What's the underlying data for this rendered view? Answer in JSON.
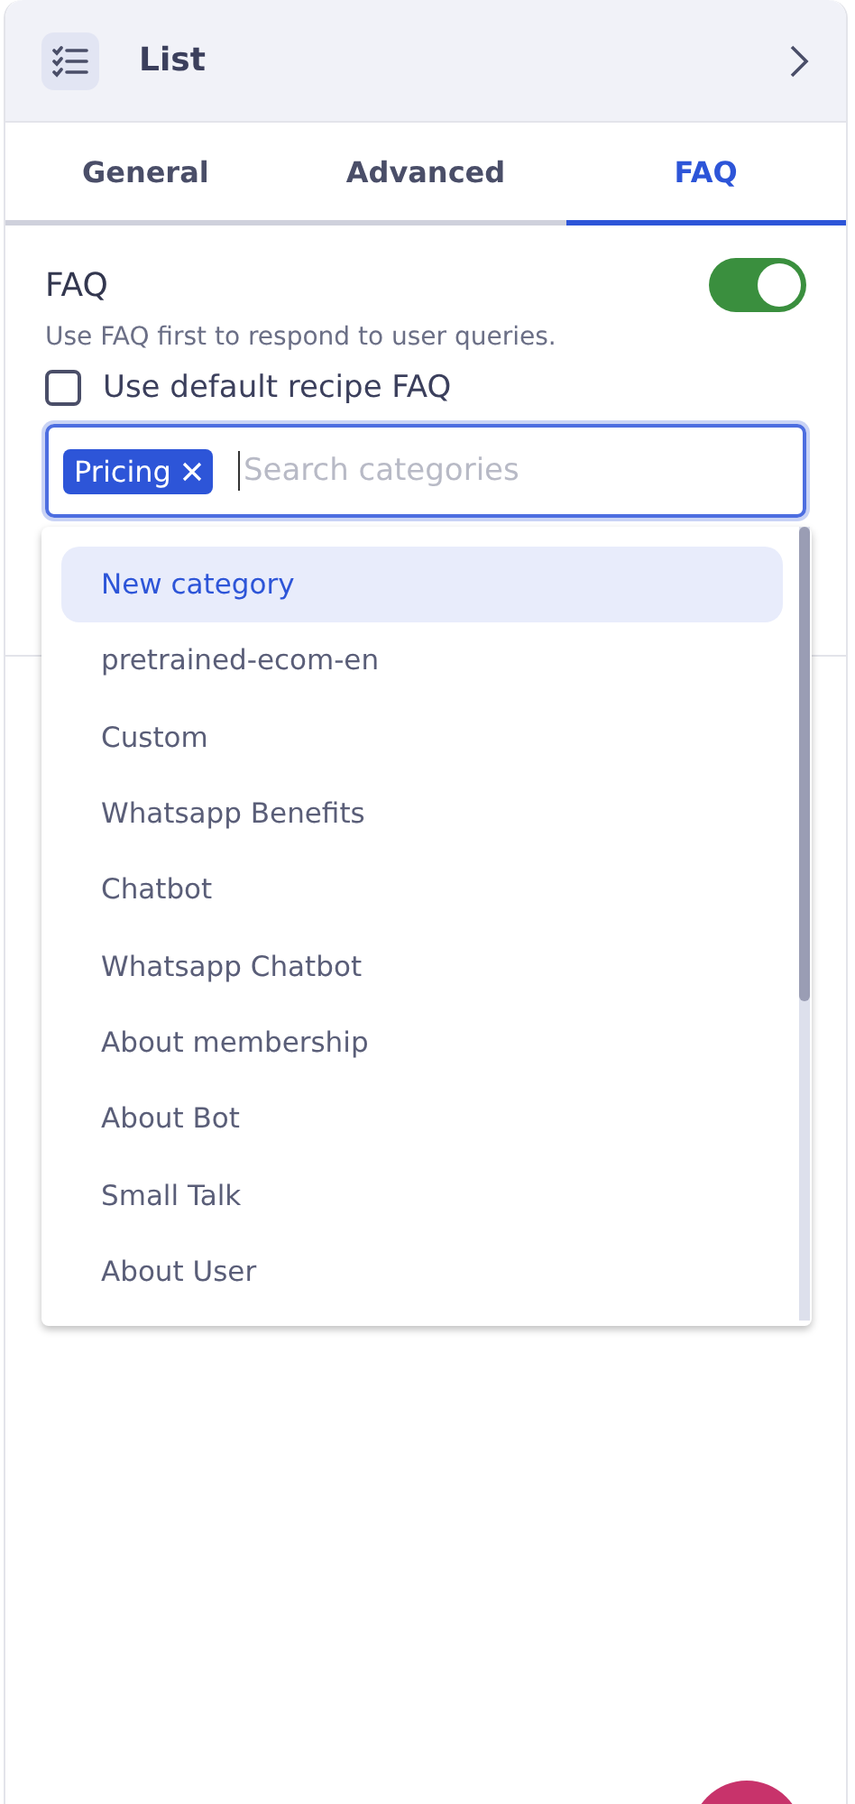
{
  "header": {
    "title": "List"
  },
  "tabs": [
    {
      "label": "General",
      "selected": false
    },
    {
      "label": "Advanced",
      "selected": false
    },
    {
      "label": "FAQ",
      "selected": true
    }
  ],
  "faq": {
    "title": "FAQ",
    "on": true,
    "description": "Use FAQ first to respond to user queries.",
    "default_recipe": {
      "label": "Use default recipe FAQ",
      "checked": false
    }
  },
  "category_field": {
    "tags": [
      "Pricing"
    ],
    "placeholder": "Search categories"
  },
  "dropdown": {
    "items": [
      {
        "label": "New category",
        "selected": true
      },
      {
        "label": "pretrained-ecom-en",
        "selected": false
      },
      {
        "label": "Custom",
        "selected": false
      },
      {
        "label": "Whatsapp Benefits",
        "selected": false
      },
      {
        "label": "Chatbot",
        "selected": false
      },
      {
        "label": "Whatsapp Chatbot",
        "selected": false
      },
      {
        "label": "About membership",
        "selected": false
      },
      {
        "label": "About Bot",
        "selected": false
      },
      {
        "label": "Small Talk",
        "selected": false
      },
      {
        "label": "About User",
        "selected": false
      }
    ]
  }
}
